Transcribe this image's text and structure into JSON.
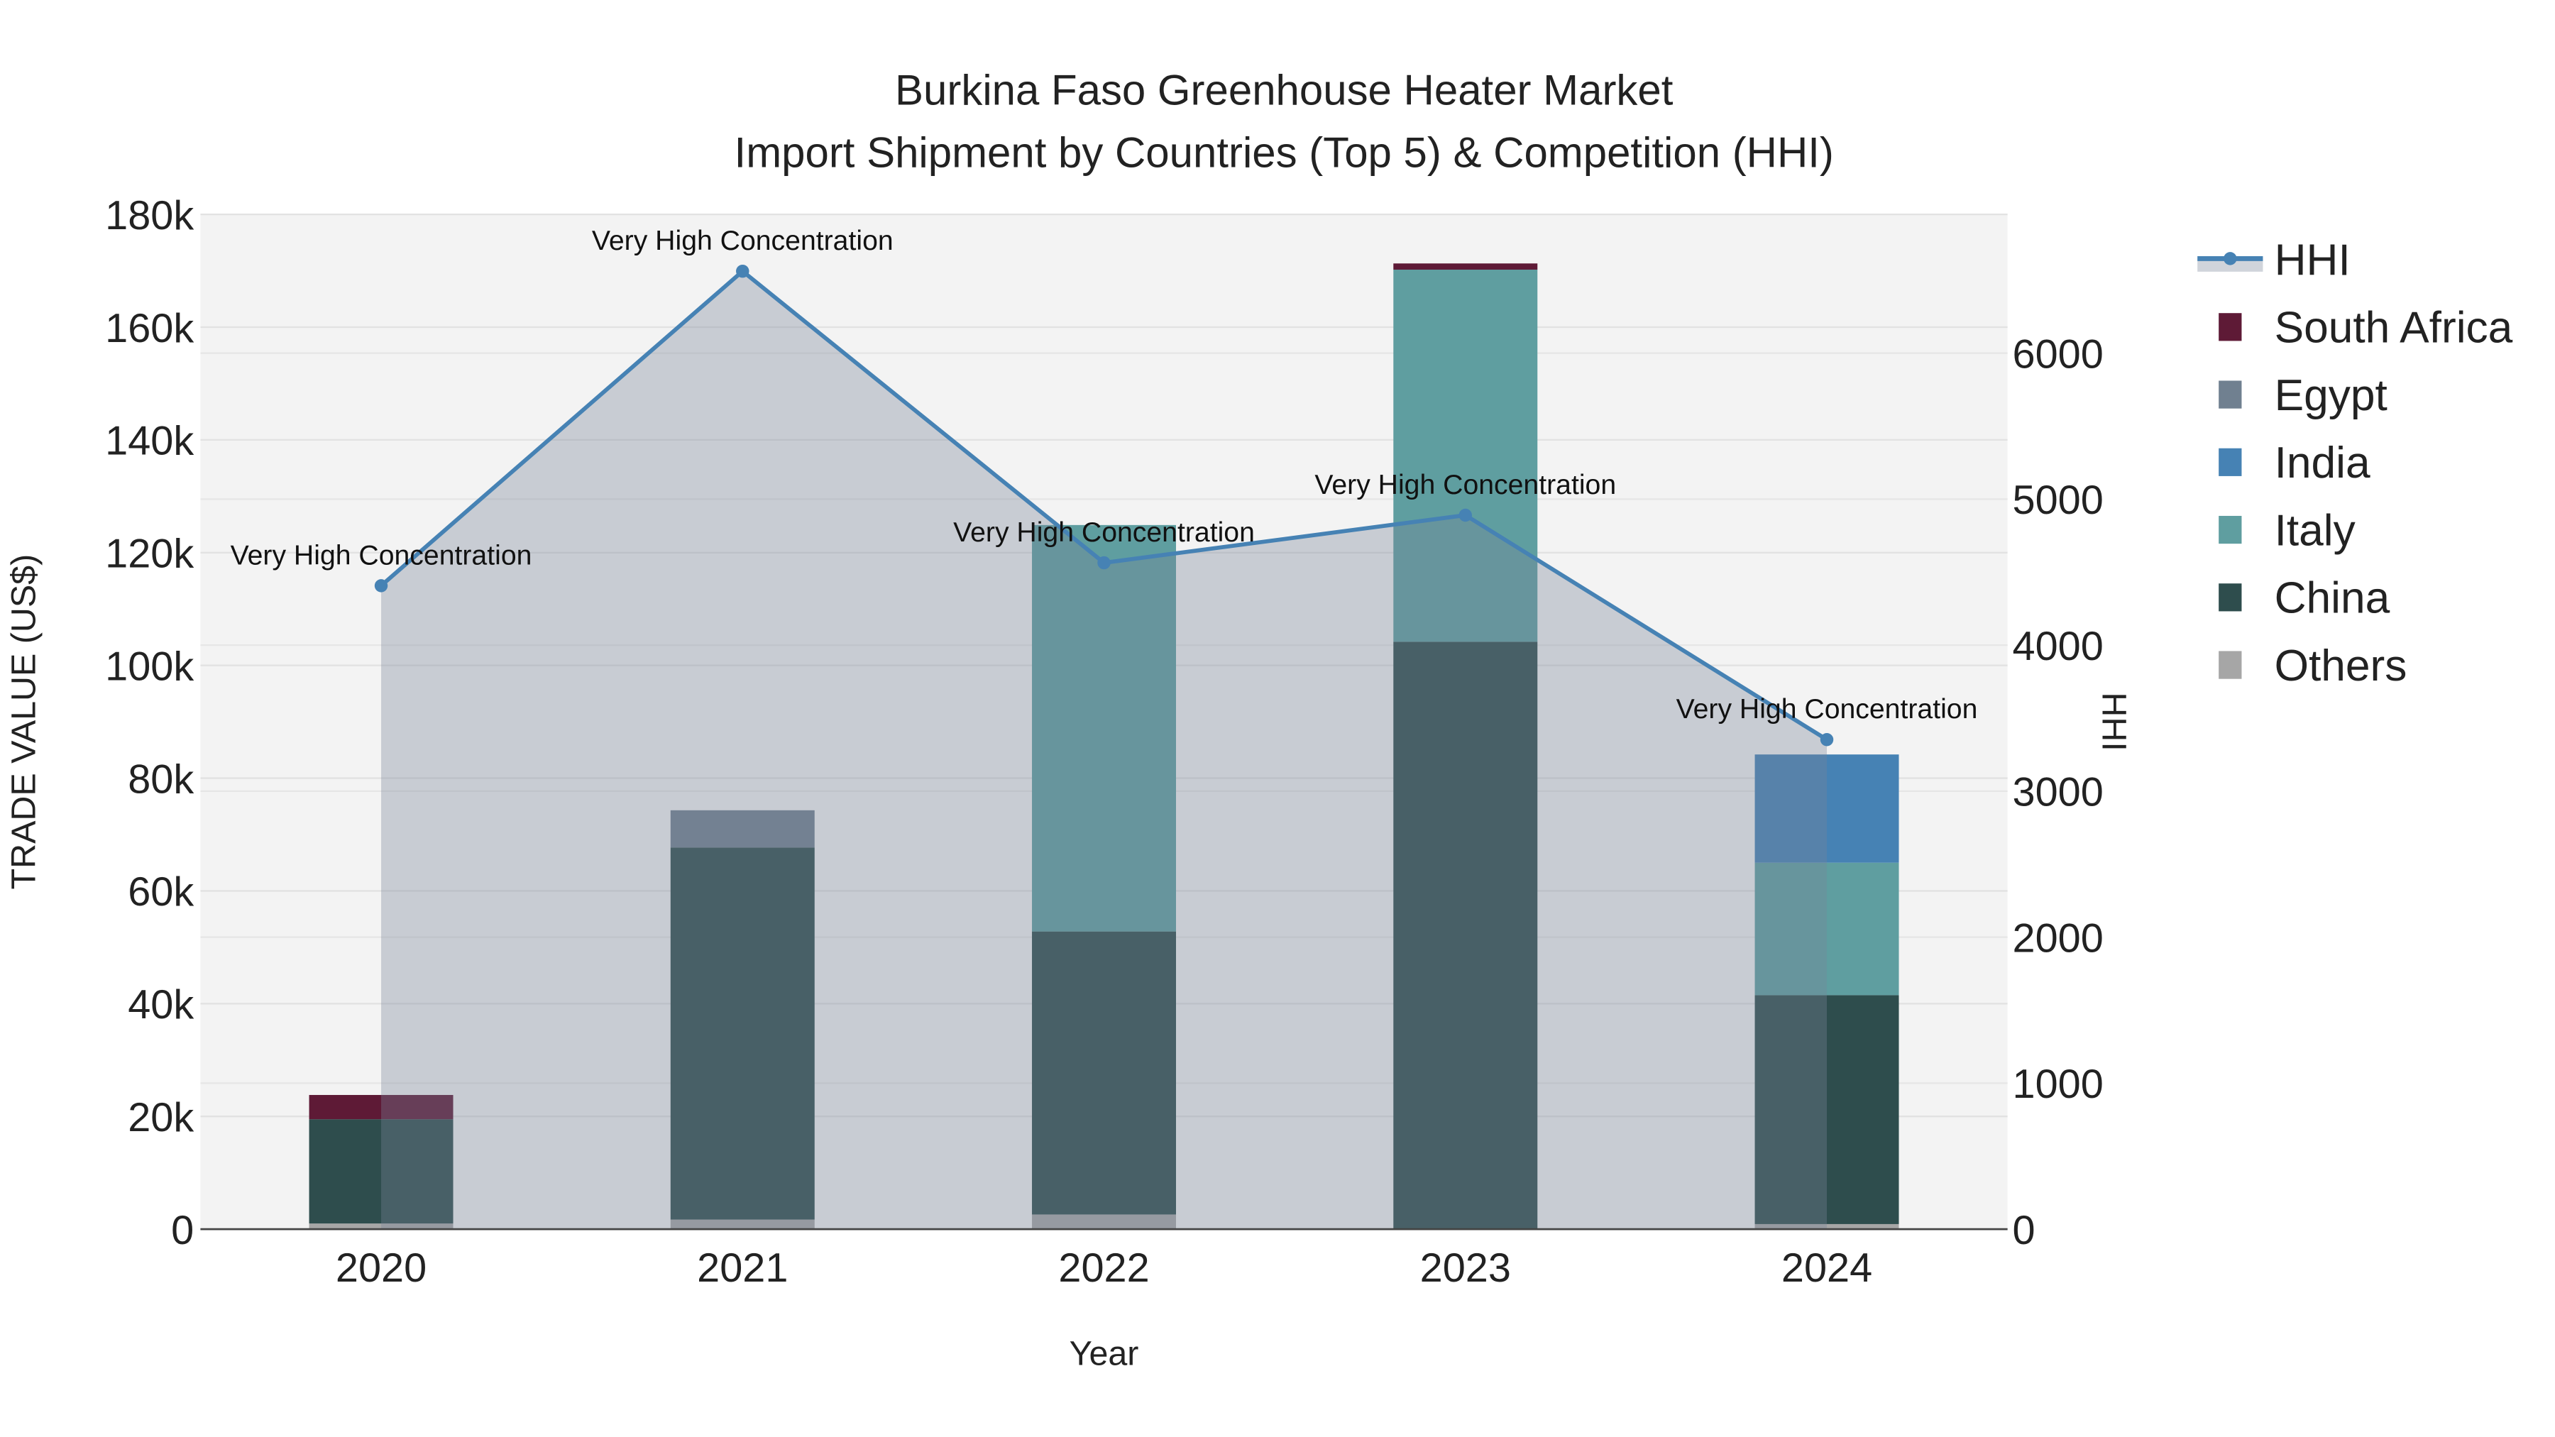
{
  "chart_data": {
    "type": "bar",
    "title": "Burkina Faso Greenhouse Heater Market",
    "subtitle": "Import Shipment by Countries (Top 5) & Competition (HHI)",
    "xlabel": "Year",
    "ylabel": "TRADE VALUE (US$)",
    "y2label": "HHI",
    "categories": [
      "2020",
      "2021",
      "2022",
      "2023",
      "2024"
    ],
    "ylim": [
      0,
      180000
    ],
    "yticks": [
      0,
      20000,
      40000,
      60000,
      80000,
      100000,
      120000,
      140000,
      160000,
      180000
    ],
    "ytick_labels": [
      "0",
      "20k",
      "40k",
      "60k",
      "80k",
      "100k",
      "120k",
      "140k",
      "160k",
      "180k"
    ],
    "y2lim": [
      0,
      6950
    ],
    "y2ticks": [
      0,
      1000,
      2000,
      3000,
      4000,
      5000,
      6000
    ],
    "y2tick_labels": [
      "0",
      "1000",
      "2000",
      "3000",
      "4000",
      "5000",
      "6000"
    ],
    "series": [
      {
        "name": "Others",
        "color": "#a6a6a6",
        "values": [
          1000,
          1700,
          2600,
          0,
          900
        ]
      },
      {
        "name": "China",
        "color": "#2e4d4d",
        "values": [
          18500,
          66000,
          50200,
          104200,
          40600
        ]
      },
      {
        "name": "Italy",
        "color": "#5f9ea0",
        "values": [
          0,
          0,
          72100,
          66000,
          23500
        ]
      },
      {
        "name": "India",
        "color": "#4682b4",
        "values": [
          0,
          0,
          0,
          0,
          19200
        ]
      },
      {
        "name": "Egypt",
        "color": "#708090",
        "values": [
          0,
          6600,
          0,
          0,
          0
        ]
      },
      {
        "name": "South Africa",
        "color": "#5e1a36",
        "values": [
          4300,
          0,
          0,
          1100,
          0
        ]
      }
    ],
    "hhi": {
      "name": "HHI",
      "color": "#4682b4",
      "values": [
        4407,
        6561,
        4564,
        4890,
        3353
      ],
      "annotations": [
        "Very High Concentration",
        "Very High Concentration",
        "Very High Concentration",
        "Very High Concentration",
        "Very High Concentration"
      ]
    },
    "legend": [
      "HHI",
      "South Africa",
      "Egypt",
      "India",
      "Italy",
      "China",
      "Others"
    ],
    "legend_placement": "right",
    "grid": true
  }
}
